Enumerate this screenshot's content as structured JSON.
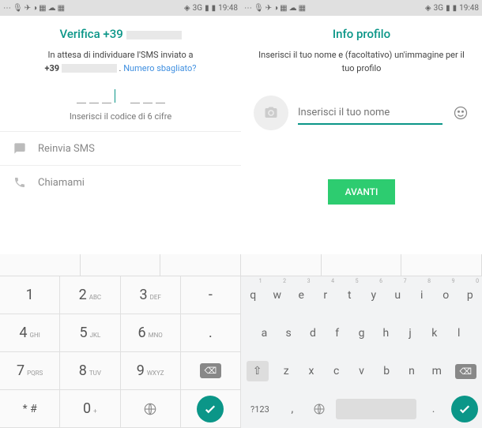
{
  "status": {
    "network": "3G",
    "time": "19:48"
  },
  "left": {
    "title": "Verifica +39",
    "wait1": "In attesa di individuare l'SMS inviato a",
    "prefix": "+39",
    "wrong": "Numero sbagliato?",
    "codeLabel": "Inserisci il codice di 6 cifre",
    "resend": "Reinvia SMS",
    "callme": "Chiamami"
  },
  "right": {
    "title": "Info profilo",
    "subtitle": "Inserisci il tuo nome e (facoltativo) un'immagine per il tuo profilo",
    "placeholder": "Inserisci il tuo nome",
    "next": "AVANTI"
  },
  "numpad": {
    "k1": "1",
    "k2": "2",
    "k2s": "ABC",
    "k3": "3",
    "k3s": "DEF",
    "dash": "-",
    "k4": "4",
    "k4s": "GHI",
    "k5": "5",
    "k5s": "JKL",
    "k6": "6",
    "k6s": "MNO",
    "dot": ".",
    "k7": "7",
    "k7s": "PQRS",
    "k8": "8",
    "k8s": "TUV",
    "k9": "9",
    "k9s": "WXYZ",
    "star": "* #",
    "k0": "0",
    "k0s": "+"
  },
  "qwerty": {
    "r1": [
      "q",
      "w",
      "e",
      "r",
      "t",
      "y",
      "u",
      "i",
      "o",
      "p"
    ],
    "r1n": [
      "1",
      "2",
      "3",
      "4",
      "5",
      "6",
      "7",
      "8",
      "9",
      "0"
    ],
    "r2": [
      "a",
      "s",
      "d",
      "f",
      "g",
      "h",
      "j",
      "k",
      "l"
    ],
    "r3": [
      "z",
      "x",
      "c",
      "v",
      "b",
      "n",
      "m"
    ],
    "sym": "?123",
    "comma": ",",
    "period": "."
  }
}
